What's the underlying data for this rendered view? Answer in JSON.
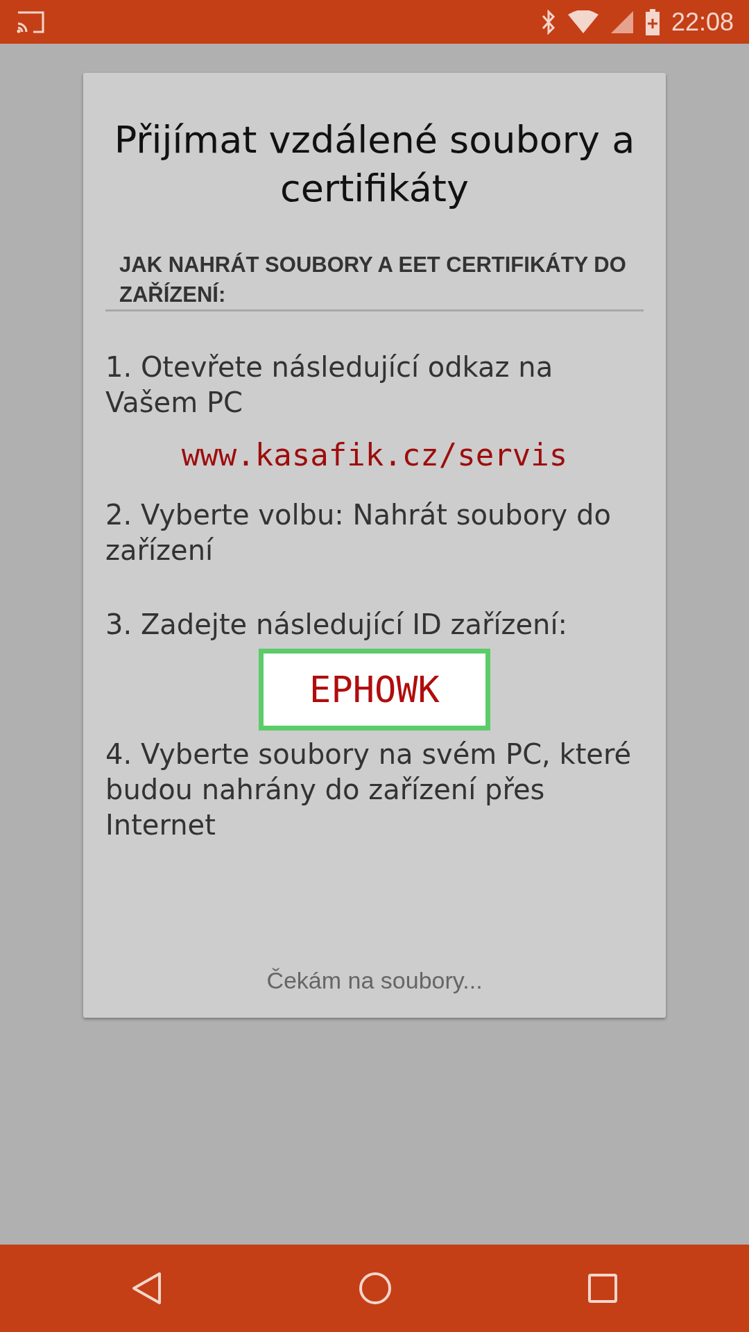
{
  "status_bar": {
    "time": "22:08"
  },
  "dialog": {
    "title": "Přijímat vzdálené soubory a certifikáty",
    "heading": "JAK NAHRÁT SOUBORY A EET CERTIFIKÁTY DO ZAŘÍZENÍ:",
    "items": [
      {
        "kind": "instruction",
        "text": "1. Otevřete následující odkaz na Vašem PC"
      },
      {
        "kind": "link",
        "text": "www.kasafik.cz/servis"
      },
      {
        "kind": "instruction",
        "text": "2. Vyberte volbu: Nahrát soubory do zařízení"
      },
      {
        "kind": "instruction",
        "text": "3. Zadejte následující ID zařízení:"
      },
      {
        "kind": "device-id",
        "text": "EPHOWK"
      },
      {
        "kind": "instruction",
        "text": "4. Vyberte soubory na svém PC, které budou nahrány do zařízení přes Internet"
      }
    ],
    "status_text": "Čekám na soubory..."
  }
}
